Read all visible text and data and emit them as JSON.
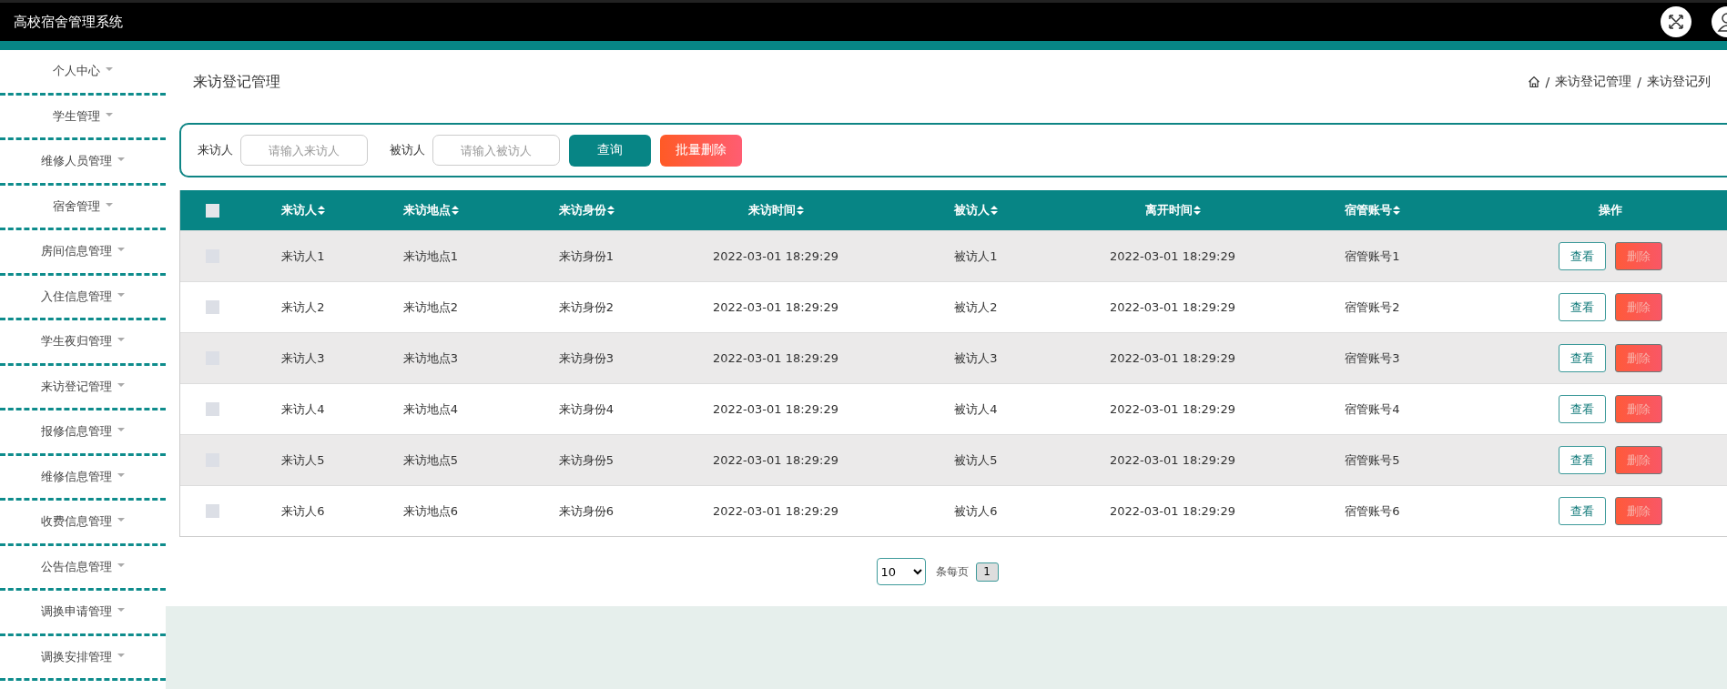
{
  "header": {
    "title": "高校宿舍管理系统"
  },
  "sidebar": {
    "items": [
      {
        "label": "个人中心"
      },
      {
        "label": "学生管理"
      },
      {
        "label": "维修人员管理"
      },
      {
        "label": "宿舍管理"
      },
      {
        "label": "房间信息管理"
      },
      {
        "label": "入住信息管理"
      },
      {
        "label": "学生夜归管理"
      },
      {
        "label": "来访登记管理"
      },
      {
        "label": "报修信息管理"
      },
      {
        "label": "维修信息管理"
      },
      {
        "label": "收费信息管理"
      },
      {
        "label": "公告信息管理"
      },
      {
        "label": "调换申请管理"
      },
      {
        "label": "调换安排管理"
      }
    ]
  },
  "page_title": "来访登记管理",
  "breadcrumb": [
    {
      "separator": "/",
      "label": "来访登记管理"
    },
    {
      "separator": "/",
      "label": "来访登记列"
    }
  ],
  "search": {
    "fields": [
      {
        "label": "来访人",
        "placeholder": "请输入来访人"
      },
      {
        "label": "被访人",
        "placeholder": "请输入被访人"
      }
    ],
    "buttons": [
      {
        "label": "查询",
        "kind": "primary"
      },
      {
        "label": "批量删除",
        "kind": "danger"
      }
    ]
  },
  "table": {
    "select_all": {
      "checked": false
    },
    "columns": [
      {
        "label": "来访人",
        "sortable": true
      },
      {
        "label": "来访地点",
        "sortable": true
      },
      {
        "label": "来访身份",
        "sortable": true
      },
      {
        "label": "来访时间",
        "sortable": true
      },
      {
        "label": "被访人",
        "sortable": true
      },
      {
        "label": "离开时间",
        "sortable": true
      },
      {
        "label": "宿管账号",
        "sortable": true
      },
      {
        "label": "操作",
        "sortable": false
      }
    ],
    "rows": [
      {
        "checked": false,
        "cells": [
          "来访人1",
          "来访地点1",
          "来访身份1",
          "2022-03-01 18:29:29",
          "被访人1",
          "2022-03-01 18:29:29",
          "宿管账号1"
        ],
        "actions": [
          {
            "label": "查看",
            "kind": "view"
          },
          {
            "label": "删除",
            "kind": "delete"
          }
        ]
      },
      {
        "checked": false,
        "cells": [
          "来访人2",
          "来访地点2",
          "来访身份2",
          "2022-03-01 18:29:29",
          "被访人2",
          "2022-03-01 18:29:29",
          "宿管账号2"
        ],
        "actions": [
          {
            "label": "查看",
            "kind": "view"
          },
          {
            "label": "删除",
            "kind": "delete"
          }
        ]
      },
      {
        "checked": false,
        "cells": [
          "来访人3",
          "来访地点3",
          "来访身份3",
          "2022-03-01 18:29:29",
          "被访人3",
          "2022-03-01 18:29:29",
          "宿管账号3"
        ],
        "actions": [
          {
            "label": "查看",
            "kind": "view"
          },
          {
            "label": "删除",
            "kind": "delete"
          }
        ]
      },
      {
        "checked": false,
        "cells": [
          "来访人4",
          "来访地点4",
          "来访身份4",
          "2022-03-01 18:29:29",
          "被访人4",
          "2022-03-01 18:29:29",
          "宿管账号4"
        ],
        "actions": [
          {
            "label": "查看",
            "kind": "view"
          },
          {
            "label": "删除",
            "kind": "delete"
          }
        ]
      },
      {
        "checked": false,
        "cells": [
          "来访人5",
          "来访地点5",
          "来访身份5",
          "2022-03-01 18:29:29",
          "被访人5",
          "2022-03-01 18:29:29",
          "宿管账号5"
        ],
        "actions": [
          {
            "label": "查看",
            "kind": "view"
          },
          {
            "label": "删除",
            "kind": "delete"
          }
        ]
      },
      {
        "checked": false,
        "cells": [
          "来访人6",
          "来访地点6",
          "来访身份6",
          "2022-03-01 18:29:29",
          "被访人6",
          "2022-03-01 18:29:29",
          "宿管账号6"
        ],
        "actions": [
          {
            "label": "查看",
            "kind": "view"
          },
          {
            "label": "删除",
            "kind": "delete"
          }
        ]
      }
    ]
  },
  "pagination": {
    "page_size": "10",
    "per_page_label": "条每页",
    "pages": [
      {
        "label": "1",
        "selected": true
      }
    ]
  }
}
